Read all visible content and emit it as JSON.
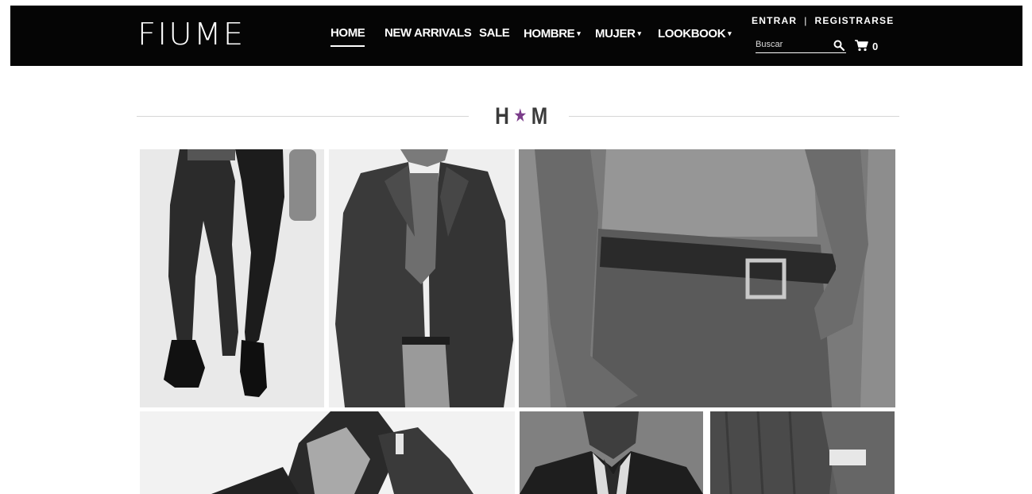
{
  "brand": {
    "logo": "FIUME"
  },
  "nav": {
    "items": [
      {
        "label": "HOME",
        "caret": ""
      },
      {
        "label": "NEW ARRIVALS",
        "caret": ""
      },
      {
        "label": "SALE",
        "caret": ""
      },
      {
        "label": "HOMBRE",
        "caret": "▾"
      },
      {
        "label": "MUJER",
        "caret": "▾"
      },
      {
        "label": "LOOKBOOK",
        "caret": "▾"
      }
    ]
  },
  "account": {
    "login": "ENTRAR",
    "separator": "|",
    "register": "REGISTRARSE"
  },
  "search": {
    "placeholder": "Buscar",
    "icon": "search-icon"
  },
  "cart": {
    "icon": "cart-icon",
    "count": "0"
  },
  "section": {
    "left": "H",
    "star": "★",
    "right": "M"
  },
  "colors": {
    "header_bg": "#050505",
    "accent_star": "#7b3d8a"
  }
}
